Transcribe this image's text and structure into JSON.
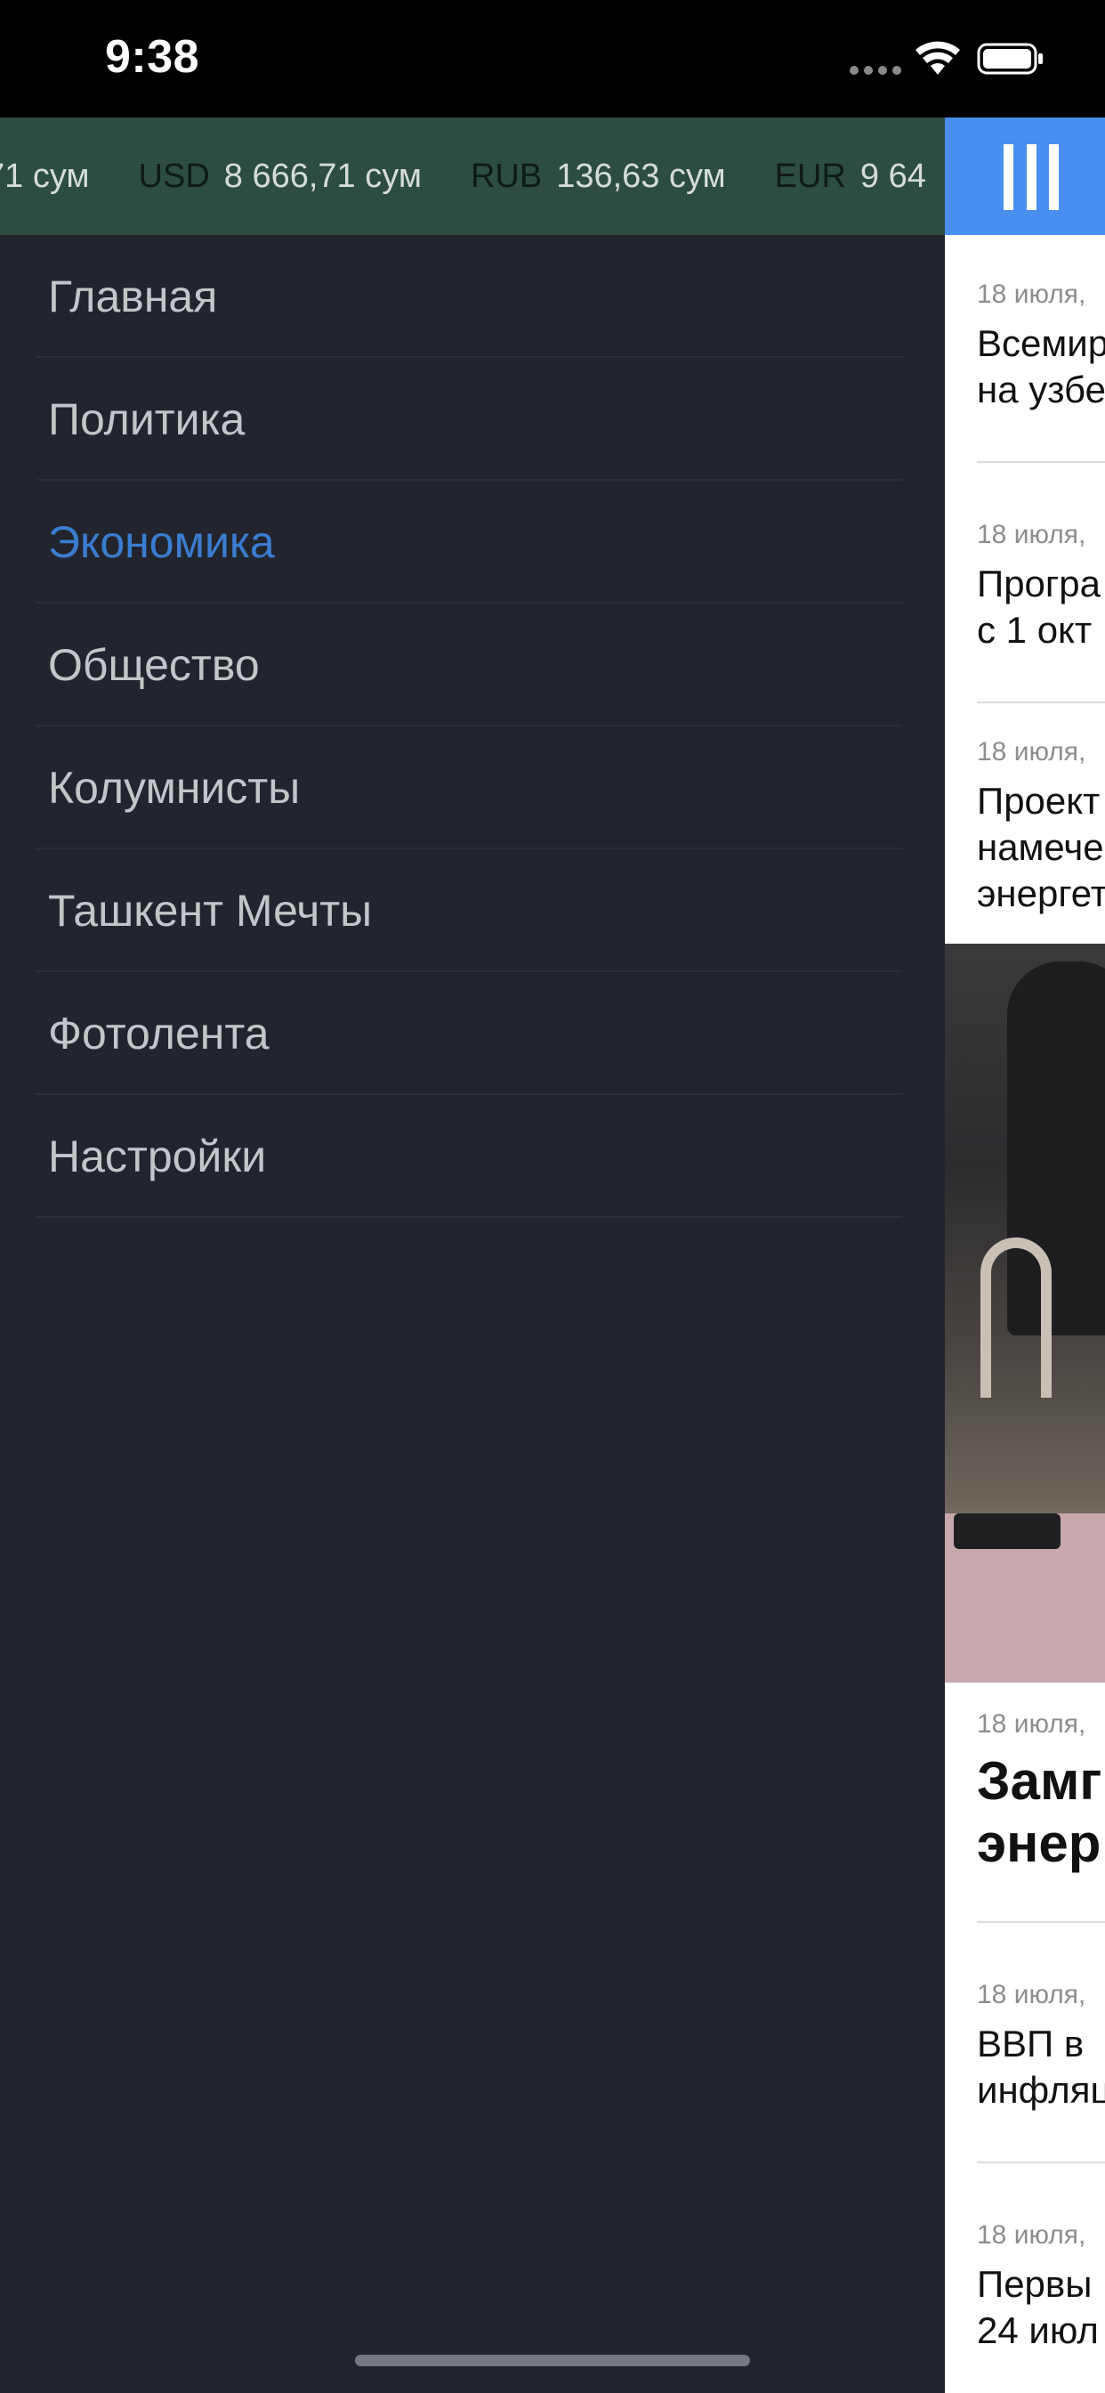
{
  "status_bar": {
    "time": "9:38",
    "icons": [
      "cellular-signal-icon",
      "wifi-icon",
      "battery-icon"
    ]
  },
  "ticker": {
    "items": [
      {
        "code": "",
        "value": "71 сум"
      },
      {
        "code": "USD",
        "value": "8 666,71 сум"
      },
      {
        "code": "RUB",
        "value": "136,63 сум"
      },
      {
        "code": "EUR",
        "value": "9 64"
      }
    ]
  },
  "menu": {
    "items": [
      {
        "label": "Главная"
      },
      {
        "label": "Политика"
      },
      {
        "label": "Экономика",
        "active": true
      },
      {
        "label": "Общество"
      },
      {
        "label": "Колумнисты"
      },
      {
        "label": "Ташкент Мечты"
      },
      {
        "label": "Фотолента"
      },
      {
        "label": "Настройки"
      }
    ]
  },
  "nav": {
    "menu_icon": "menu-icon"
  },
  "news": [
    {
      "date": "18 июля,",
      "title": "Всемир\nна узбе"
    },
    {
      "date": "18 июля,",
      "title": "Програ\nс 1 окт"
    },
    {
      "date": "18 июля,",
      "title": "Проект\nнамече\nэнергет"
    },
    {
      "date": "18 июля,",
      "title": "Замг\nэнер"
    },
    {
      "date": "18 июля,",
      "title": "ВВП в\nинфляц"
    },
    {
      "date": "18 июля,",
      "title": "Первы\n24 июл"
    }
  ],
  "colors": {
    "ticker_bg": "#2d4c42",
    "menu_bg": "#22252d",
    "menu_text": "#c4c5c8",
    "menu_active": "#3a7dd1",
    "nav_bar": "#4a8ff0"
  }
}
